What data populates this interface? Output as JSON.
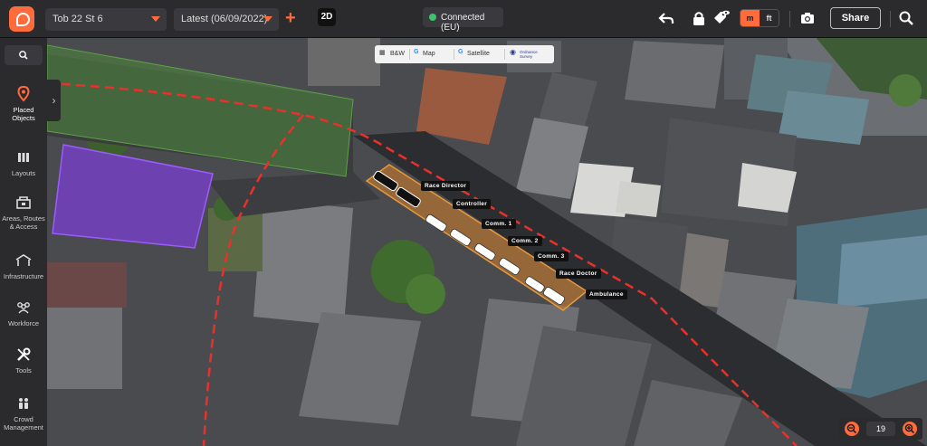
{
  "header": {
    "project": "Tob 22 St 6",
    "version": "Latest (06/09/2022)",
    "mode": "2D",
    "status": "Connected (EU)",
    "units": {
      "metric": "m",
      "imperial": "ft",
      "selected": "m"
    },
    "share_label": "Share"
  },
  "sidebar": {
    "items": [
      {
        "label_line1": "Placed",
        "label_line2": "Objects",
        "icon": "location-pin-icon",
        "active": true
      },
      {
        "label_line1": "Layouts",
        "label_line2": "",
        "icon": "layouts-icon",
        "active": false
      },
      {
        "label_line1": "Areas, Routes",
        "label_line2": "& Access",
        "icon": "areas-icon",
        "active": false
      },
      {
        "label_line1": "Infrastructure",
        "label_line2": "",
        "icon": "infrastructure-icon",
        "active": false
      },
      {
        "label_line1": "Workforce",
        "label_line2": "",
        "icon": "workforce-icon",
        "active": false
      },
      {
        "label_line1": "Tools",
        "label_line2": "",
        "icon": "tools-icon",
        "active": false
      },
      {
        "label_line1": "Crowd",
        "label_line2": "Management",
        "icon": "crowd-icon",
        "active": false
      }
    ]
  },
  "map_layers": {
    "bw": "B&W",
    "map": "Map",
    "satellite": "Satellite",
    "osm": "Ordnance Survey"
  },
  "vehicle_labels": [
    "Race Director",
    "Controller",
    "Comm. 1",
    "Comm. 2",
    "Comm. 3",
    "Race Doctor",
    "Ambulance"
  ],
  "zoom": {
    "level": "19"
  },
  "colors": {
    "accent": "#ff6b3a",
    "route": "#e8312b",
    "zone_purple": "#7a3fd0",
    "zone_green": "#4f8a3c",
    "zone_orange": "#c97a2a"
  }
}
